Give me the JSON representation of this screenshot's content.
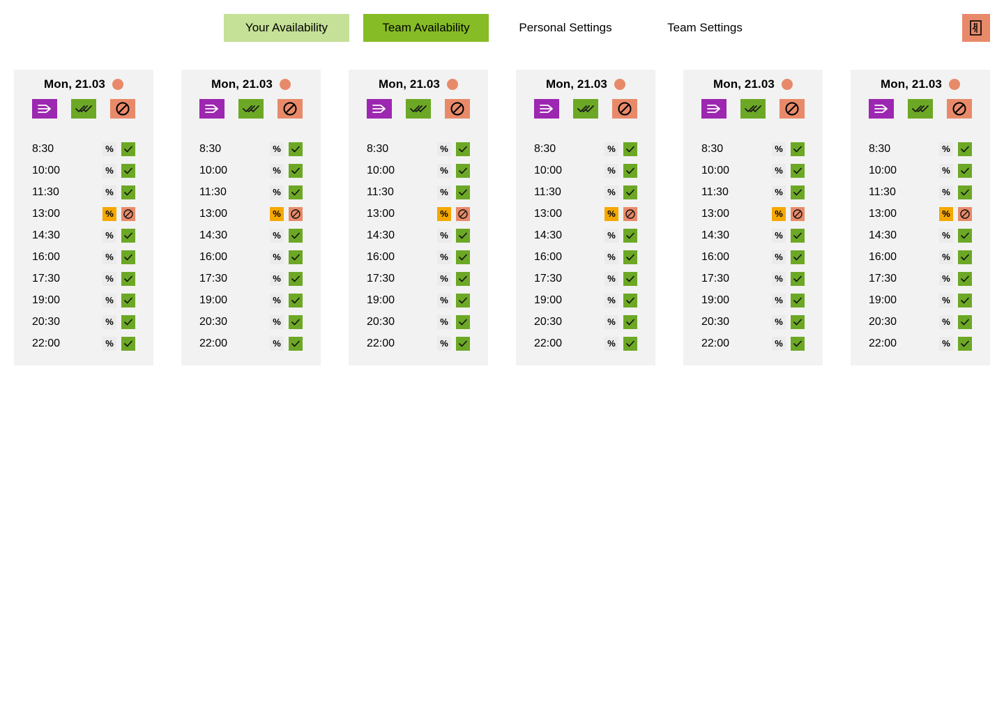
{
  "nav": {
    "tabs": [
      {
        "label": "Your Availability"
      },
      {
        "label": "Team Availability"
      },
      {
        "label": "Personal Settings"
      },
      {
        "label": "Team Settings"
      }
    ],
    "logout_icon": "exit-door-icon"
  },
  "colors": {
    "tab_light": "#c5e097",
    "tab_active": "#86bc25",
    "accent_salmon": "#e88a69",
    "accent_purple": "#9c27b0",
    "accent_green": "#6ca825",
    "highlight_orange": "#f5a800",
    "card_bg": "#f2f2f2"
  },
  "days": [
    {
      "date": "Mon, 21.03"
    },
    {
      "date": "Mon, 21.03"
    },
    {
      "date": "Mon, 21.03"
    },
    {
      "date": "Mon, 21.03"
    },
    {
      "date": "Mon, 21.03"
    },
    {
      "date": "Mon, 21.03"
    }
  ],
  "actions": {
    "icons": [
      "arrow-right-lines-icon",
      "double-check-icon",
      "blocked-icon"
    ]
  },
  "slots": [
    {
      "time": "8:30",
      "percent": "%",
      "status": "available"
    },
    {
      "time": "10:00",
      "percent": "%",
      "status": "available"
    },
    {
      "time": "11:30",
      "percent": "%",
      "status": "available"
    },
    {
      "time": "13:00",
      "percent": "%",
      "status": "blocked",
      "highlighted": true
    },
    {
      "time": "14:30",
      "percent": "%",
      "status": "available"
    },
    {
      "time": "16:00",
      "percent": "%",
      "status": "available"
    },
    {
      "time": "17:30",
      "percent": "%",
      "status": "available"
    },
    {
      "time": "19:00",
      "percent": "%",
      "status": "available"
    },
    {
      "time": "20:30",
      "percent": "%",
      "status": "available"
    },
    {
      "time": "22:00",
      "percent": "%",
      "status": "available"
    }
  ]
}
